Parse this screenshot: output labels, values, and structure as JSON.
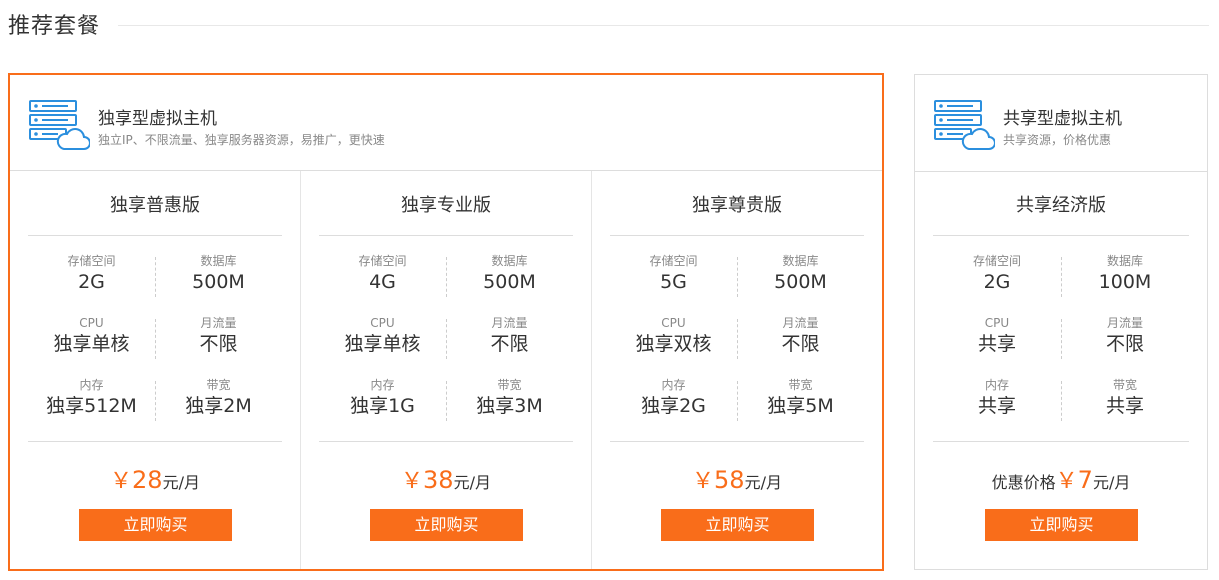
{
  "section": {
    "title": "推荐套餐"
  },
  "colors": {
    "accent": "#f96d1a",
    "icon_blue": "#2b8fde"
  },
  "featured": {
    "icon": "server-cloud-icon",
    "title": "独享型虚拟主机",
    "desc": "独立IP、不限流量、独享服务器资源，易推广，更快速",
    "plans": [
      {
        "name": "独享普惠版",
        "specs": [
          {
            "label": "存储空间",
            "value": "2G"
          },
          {
            "label": "数据库",
            "value": "500M"
          },
          {
            "label": "CPU",
            "value": "独享单核"
          },
          {
            "label": "月流量",
            "value": "不限"
          },
          {
            "label": "内存",
            "value": "独享512M"
          },
          {
            "label": "带宽",
            "value": "独享2M"
          }
        ],
        "price": {
          "prefix": "",
          "currency": "￥",
          "amount": "28",
          "unit": "元/月"
        },
        "buy_label": "立即购买"
      },
      {
        "name": "独享专业版",
        "specs": [
          {
            "label": "存储空间",
            "value": "4G"
          },
          {
            "label": "数据库",
            "value": "500M"
          },
          {
            "label": "CPU",
            "value": "独享单核"
          },
          {
            "label": "月流量",
            "value": "不限"
          },
          {
            "label": "内存",
            "value": "独享1G"
          },
          {
            "label": "带宽",
            "value": "独享3M"
          }
        ],
        "price": {
          "prefix": "",
          "currency": "￥",
          "amount": "38",
          "unit": "元/月"
        },
        "buy_label": "立即购买"
      },
      {
        "name": "独享尊贵版",
        "specs": [
          {
            "label": "存储空间",
            "value": "5G"
          },
          {
            "label": "数据库",
            "value": "500M"
          },
          {
            "label": "CPU",
            "value": "独享双核"
          },
          {
            "label": "月流量",
            "value": "不限"
          },
          {
            "label": "内存",
            "value": "独享2G"
          },
          {
            "label": "带宽",
            "value": "独享5M"
          }
        ],
        "price": {
          "prefix": "",
          "currency": "￥",
          "amount": "58",
          "unit": "元/月"
        },
        "buy_label": "立即购买"
      }
    ]
  },
  "shared": {
    "icon": "server-cloud-icon",
    "title": "共享型虚拟主机",
    "desc": "共享资源，价格优惠",
    "plans": [
      {
        "name": "共享经济版",
        "specs": [
          {
            "label": "存储空间",
            "value": "2G"
          },
          {
            "label": "数据库",
            "value": "100M"
          },
          {
            "label": "CPU",
            "value": "共享"
          },
          {
            "label": "月流量",
            "value": "不限"
          },
          {
            "label": "内存",
            "value": "共享"
          },
          {
            "label": "带宽",
            "value": "共享"
          }
        ],
        "price": {
          "prefix": "优惠价格",
          "currency": "￥",
          "amount": "7",
          "unit": "元/月"
        },
        "buy_label": "立即购买"
      }
    ]
  }
}
